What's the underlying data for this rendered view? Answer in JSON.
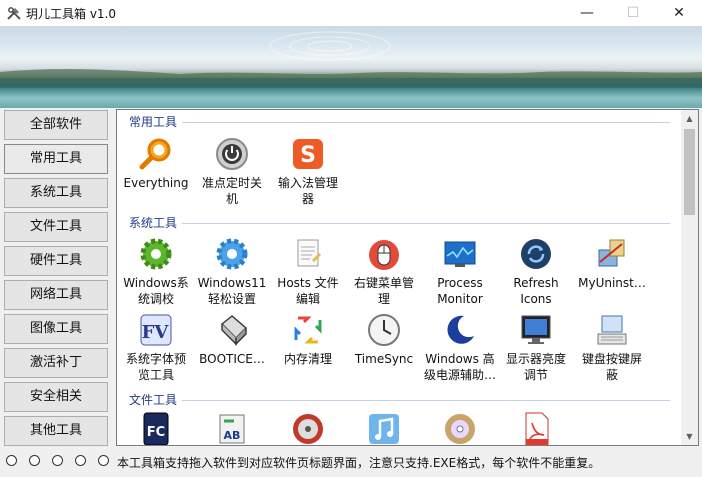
{
  "window": {
    "title": "玥儿工具箱 v1.0",
    "minimize": "—",
    "maximize": "☐",
    "close": "✕"
  },
  "sidebar": {
    "items": [
      {
        "label": "全部软件"
      },
      {
        "label": "常用工具"
      },
      {
        "label": "系统工具"
      },
      {
        "label": "文件工具"
      },
      {
        "label": "硬件工具"
      },
      {
        "label": "网络工具"
      },
      {
        "label": "图像工具"
      },
      {
        "label": "激活补丁"
      },
      {
        "label": "安全相关"
      },
      {
        "label": "其他工具"
      }
    ]
  },
  "sections": {
    "common": {
      "title": "常用工具",
      "items": [
        {
          "label": "Everything",
          "icon": "search-magnifier-icon"
        },
        {
          "label": "准点定时关\n机",
          "icon": "power-icon"
        },
        {
          "label": "输入法管理\n器",
          "icon": "sogou-input-icon"
        }
      ]
    },
    "system": {
      "title": "系统工具",
      "items": [
        {
          "label": "Windows系\n统调校",
          "icon": "green-gear-icon"
        },
        {
          "label": "Windows11\n轻松设置",
          "icon": "blue-gear-icon"
        },
        {
          "label": "Hosts 文件\n编辑",
          "icon": "notepad-icon"
        },
        {
          "label": "右键菜单管\n理",
          "icon": "mouse-icon"
        },
        {
          "label": "Process\nMonitor",
          "icon": "monitor-graph-icon"
        },
        {
          "label": "Refresh\nIcons",
          "icon": "refresh-icon"
        },
        {
          "label": "MyUninst…",
          "icon": "uninstaller-icon"
        },
        {
          "label": "系统字体预\n览工具",
          "icon": "font-preview-icon"
        },
        {
          "label": "BOOTICE…",
          "icon": "disk-icon"
        },
        {
          "label": "内存清理",
          "icon": "memory-clean-icon"
        },
        {
          "label": "TimeSync",
          "icon": "clock-icon"
        },
        {
          "label": "Windows 高\n级电源辅助…",
          "icon": "moon-icon"
        },
        {
          "label": "显示器亮度\n调节",
          "icon": "display-icon"
        },
        {
          "label": "键盘按键屏\n蔽",
          "icon": "keyboard-icon"
        }
      ]
    },
    "file": {
      "title": "文件工具",
      "items": [
        {
          "label": "",
          "icon": "fc-icon"
        },
        {
          "label": "",
          "icon": "rename-ab-icon"
        },
        {
          "label": "",
          "icon": "disc-burn-icon"
        },
        {
          "label": "",
          "icon": "music-icon"
        },
        {
          "label": "",
          "icon": "dvd-icon"
        },
        {
          "label": "",
          "icon": "pdf-icon"
        }
      ]
    }
  },
  "status": {
    "text": "本工具箱支持拖入软件到对应软件页标题界面，注意只支持.EXE格式，每个软件不能重复。"
  }
}
